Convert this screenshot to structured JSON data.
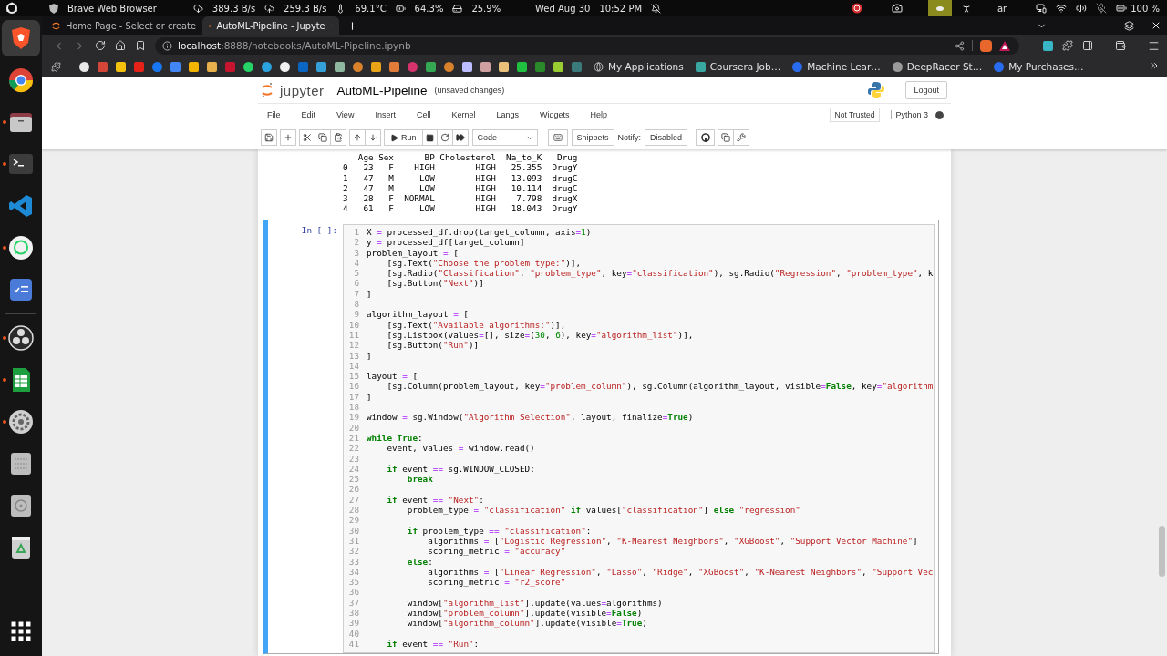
{
  "system_bar": {
    "app": "Brave Web Browser",
    "net_down": "389.3 B/s",
    "net_up": "259.3 B/s",
    "temperature": "69.1°C",
    "battery_status": "64.3%",
    "disk": "25.9%",
    "date": "Wed Aug 30",
    "time": "10:52 PM",
    "keyboard": "ar",
    "battery": "100 %"
  },
  "dock": {
    "items": [
      {
        "kind": "brave",
        "selected": true,
        "running": false
      },
      {
        "kind": "chrome",
        "selected": false,
        "running": false
      },
      {
        "kind": "files",
        "selected": false,
        "running": true
      },
      {
        "kind": "terminal",
        "selected": false,
        "running": true
      },
      {
        "kind": "vscode",
        "selected": false,
        "running": false
      },
      {
        "kind": "whatsapp",
        "selected": false,
        "running": true
      },
      {
        "kind": "tasks",
        "selected": false,
        "running": false
      },
      {
        "kind": "obs",
        "selected": false,
        "running": true
      },
      {
        "kind": "sheets",
        "selected": false,
        "running": true
      },
      {
        "kind": "settings",
        "selected": false,
        "running": true
      },
      {
        "kind": "list",
        "selected": false,
        "running": false
      },
      {
        "kind": "disc",
        "selected": false,
        "running": false
      },
      {
        "kind": "trash",
        "selected": false,
        "running": false
      }
    ]
  },
  "browser": {
    "tabs": [
      {
        "title": "Home Page - Select or create",
        "selected": false
      },
      {
        "title": "AutoML-Pipeline - Jupyte",
        "selected": true
      }
    ],
    "url_host": "localhost",
    "url_path": ":8888/notebooks/AutoML-Pipeline.ipynb",
    "bookmarks": [
      "My Applications",
      "Coursera Job…",
      "Machine Lear…",
      "DeepRacer St…",
      "My Purchases…"
    ]
  },
  "notebook": {
    "logo": "jupyter",
    "name": "AutoML-Pipeline",
    "save_status": "(unsaved changes)",
    "logout": "Logout",
    "menu": [
      "File",
      "Edit",
      "View",
      "Insert",
      "Cell",
      "Kernel",
      "Langs",
      "Widgets",
      "Help"
    ],
    "trust": "Not Trusted",
    "kernel": "Python 3",
    "toolbar": {
      "run": "Run",
      "cell_type": "Code",
      "snippets": "Snippets",
      "notify_label": "Notify:",
      "notify": "Disabled"
    },
    "output_lines": [
      "   Age Sex      BP Cholesterol  Na_to_K   Drug",
      "0   23   F    HIGH        HIGH   25.355  DrugY",
      "1   47   M     LOW        HIGH   13.093  drugC",
      "2   47   M     LOW        HIGH   10.114  drugC",
      "3   28   F  NORMAL        HIGH    7.798  drugX",
      "4   61   F     LOW        HIGH   18.043  DrugY"
    ],
    "cell": {
      "prompt": "In [ ]:",
      "selected": true,
      "lines": [
        {
          "n": "1",
          "code": "X = processed_df.drop(target_column, axis=1)"
        },
        {
          "n": "2",
          "code": "y = processed_df[target_column]"
        },
        {
          "n": "3",
          "code": "problem_layout = ["
        },
        {
          "n": "4",
          "code": "    [sg.Text(\"Choose the problem type:\")],"
        },
        {
          "n": "5",
          "code": "    [sg.Radio(\"Classification\", \"problem_type\", key=\"classification\"), sg.Radio(\"Regression\", \"problem_type\", k"
        },
        {
          "n": "6",
          "code": "    [sg.Button(\"Next\")]"
        },
        {
          "n": "7",
          "code": "]"
        },
        {
          "n": "8"
        },
        {
          "n": "9",
          "code": "algorithm_layout = ["
        },
        {
          "n": "10",
          "code": "    [sg.Text(\"Available algorithms:\")],"
        },
        {
          "n": "11",
          "code": "    [sg.Listbox(values=[], size=(30, 6), key=\"algorithm_list\")],"
        },
        {
          "n": "12",
          "code": "    [sg.Button(\"Run\")]"
        },
        {
          "n": "13",
          "code": "]"
        },
        {
          "n": "14"
        },
        {
          "n": "15",
          "code": "layout = ["
        },
        {
          "n": "16",
          "code": "    [sg.Column(problem_layout, key=\"problem_column\"), sg.Column(algorithm_layout, visible=**False**, key=\"algorithm"
        },
        {
          "n": "17",
          "code": "]"
        },
        {
          "n": "18"
        },
        {
          "n": "19",
          "code": "window = sg.Window(\"Algorithm Selection\", layout, finalize=**True**)"
        },
        {
          "n": "20"
        },
        {
          "n": "21",
          "code": "**while** **True**:"
        },
        {
          "n": "22",
          "code": "    event, values = window.read()"
        },
        {
          "n": "23"
        },
        {
          "n": "24",
          "code": "    **if** event == sg.WINDOW_CLOSED:"
        },
        {
          "n": "25",
          "code": "        **break**"
        },
        {
          "n": "26"
        },
        {
          "n": "27",
          "code": "    **if** event == \"Next\":"
        },
        {
          "n": "28",
          "code": "        problem_type = \"classification\" **if** values[\"classification\"] **else** \"regression\""
        },
        {
          "n": "29"
        },
        {
          "n": "30",
          "code": "        **if** problem_type == \"classification\":"
        },
        {
          "n": "31",
          "code": "            algorithms = [\"Logistic Regression\", \"K-Nearest Neighbors\", \"XGBoost\", \"Support Vector Machine\"]"
        },
        {
          "n": "32",
          "code": "            scoring_metric = \"accuracy\""
        },
        {
          "n": "33",
          "code": "        **else**:"
        },
        {
          "n": "34",
          "code": "            algorithms = [\"Linear Regression\", \"Lasso\", \"Ridge\", \"XGBoost\", \"K-Nearest Neighbors\", \"Support Vec"
        },
        {
          "n": "35",
          "code": "            scoring_metric = \"r2_score\""
        },
        {
          "n": "36"
        },
        {
          "n": "37",
          "code": "        window[\"algorithm_list\"].update(values=algorithms)"
        },
        {
          "n": "38",
          "code": "        window[\"problem_column\"].update(visible=**False**)"
        },
        {
          "n": "39",
          "code": "        window[\"algorithm_column\"].update(visible=**True**)"
        },
        {
          "n": "40"
        },
        {
          "n": "41",
          "code": "    **if** event == \"Run\":"
        }
      ]
    }
  }
}
